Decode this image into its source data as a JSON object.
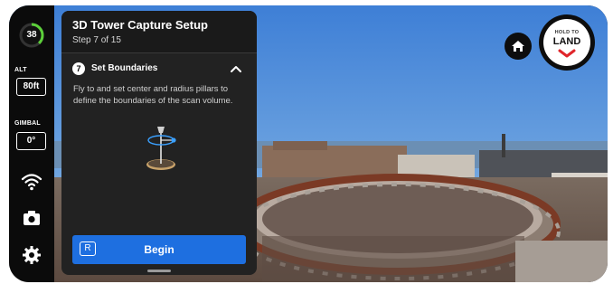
{
  "hud": {
    "battery_value": "38",
    "battery_level": 0.38,
    "alt_label": "ALT",
    "alt_value": "80ft",
    "gimbal_label": "GIMBAL",
    "gimbal_value": "0°",
    "icons": [
      "wifi-signal-icon",
      "camera-icon",
      "settings-gear-icon"
    ]
  },
  "panel": {
    "title": "3D Tower Capture Setup",
    "step": "Step 7 of 15",
    "step_number": "7",
    "step_name": "Set Boundaries",
    "instructions": "Fly to and set center and radius pillars to define the boundaries of the scan volume.",
    "begin_key": "R",
    "begin_label": "Begin"
  },
  "controls": {
    "land_small": "HOLD TO",
    "land_big": "LAND"
  },
  "colors": {
    "accent_blue": "#1e6fe0",
    "battery_green": "#5ccf3a",
    "land_red": "#e0262b",
    "illustration_blue": "#3aa0ff"
  }
}
